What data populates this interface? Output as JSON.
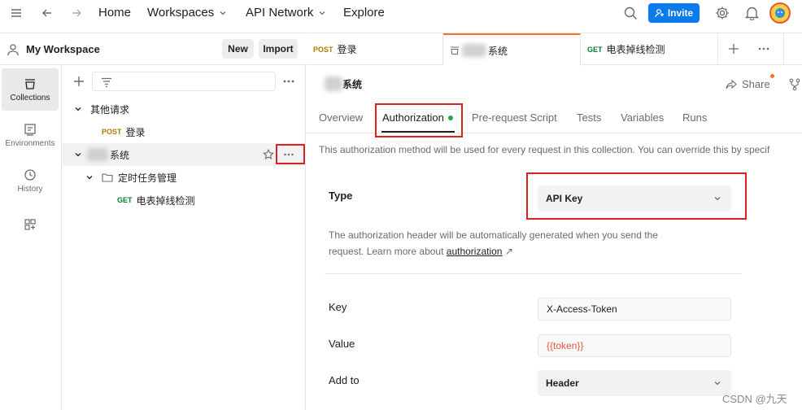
{
  "topbar": {
    "home": "Home",
    "workspaces": "Workspaces",
    "api_network": "API Network",
    "explore": "Explore",
    "invite": "Invite"
  },
  "workspace": {
    "title": "My Workspace",
    "new_label": "New",
    "import_label": "Import"
  },
  "rail": [
    {
      "label": "Collections",
      "icon": "collections-icon"
    },
    {
      "label": "Environments",
      "icon": "environments-icon"
    },
    {
      "label": "History",
      "icon": "history-icon"
    },
    {
      "label": "",
      "icon": "add-widget-icon"
    }
  ],
  "tree": {
    "folder1": "其他请求",
    "req1_method": "POST",
    "req1_name": "登录",
    "collection_name": "系统",
    "folder2": "定时任务管理",
    "req2_method": "GET",
    "req2_name": "电表掉线检测"
  },
  "tabs": [
    {
      "method": "POST",
      "name": "登录"
    },
    {
      "method": "",
      "name": "系统"
    },
    {
      "method": "GET",
      "name": "电表掉线检测"
    }
  ],
  "content": {
    "collection_title": "系统",
    "share": "Share",
    "subtabs": [
      "Overview",
      "Authorization",
      "Pre-request Script",
      "Tests",
      "Variables",
      "Runs"
    ],
    "description": "This authorization method will be used for every request in this collection. You can override this by specif",
    "type_label": "Type",
    "type_value": "API Key",
    "help_line1": "The authorization header will be automatically generated when you send the",
    "help_line2_prefix": "request. Learn more about ",
    "help_link": "authorization",
    "help_arrow": "↗",
    "key_label": "Key",
    "key_value": "X-Access-Token",
    "value_label": "Value",
    "value_value": "{{token}}",
    "addto_label": "Add to",
    "addto_value": "Header"
  },
  "watermark": "CSDN @九天",
  "colors": {
    "accent_orange": "#ff6c37",
    "invite_blue": "#097bed",
    "annotation_red": "#e02020",
    "post": "#ad7a03",
    "get": "#007f31",
    "variable": "#e05a3a"
  }
}
